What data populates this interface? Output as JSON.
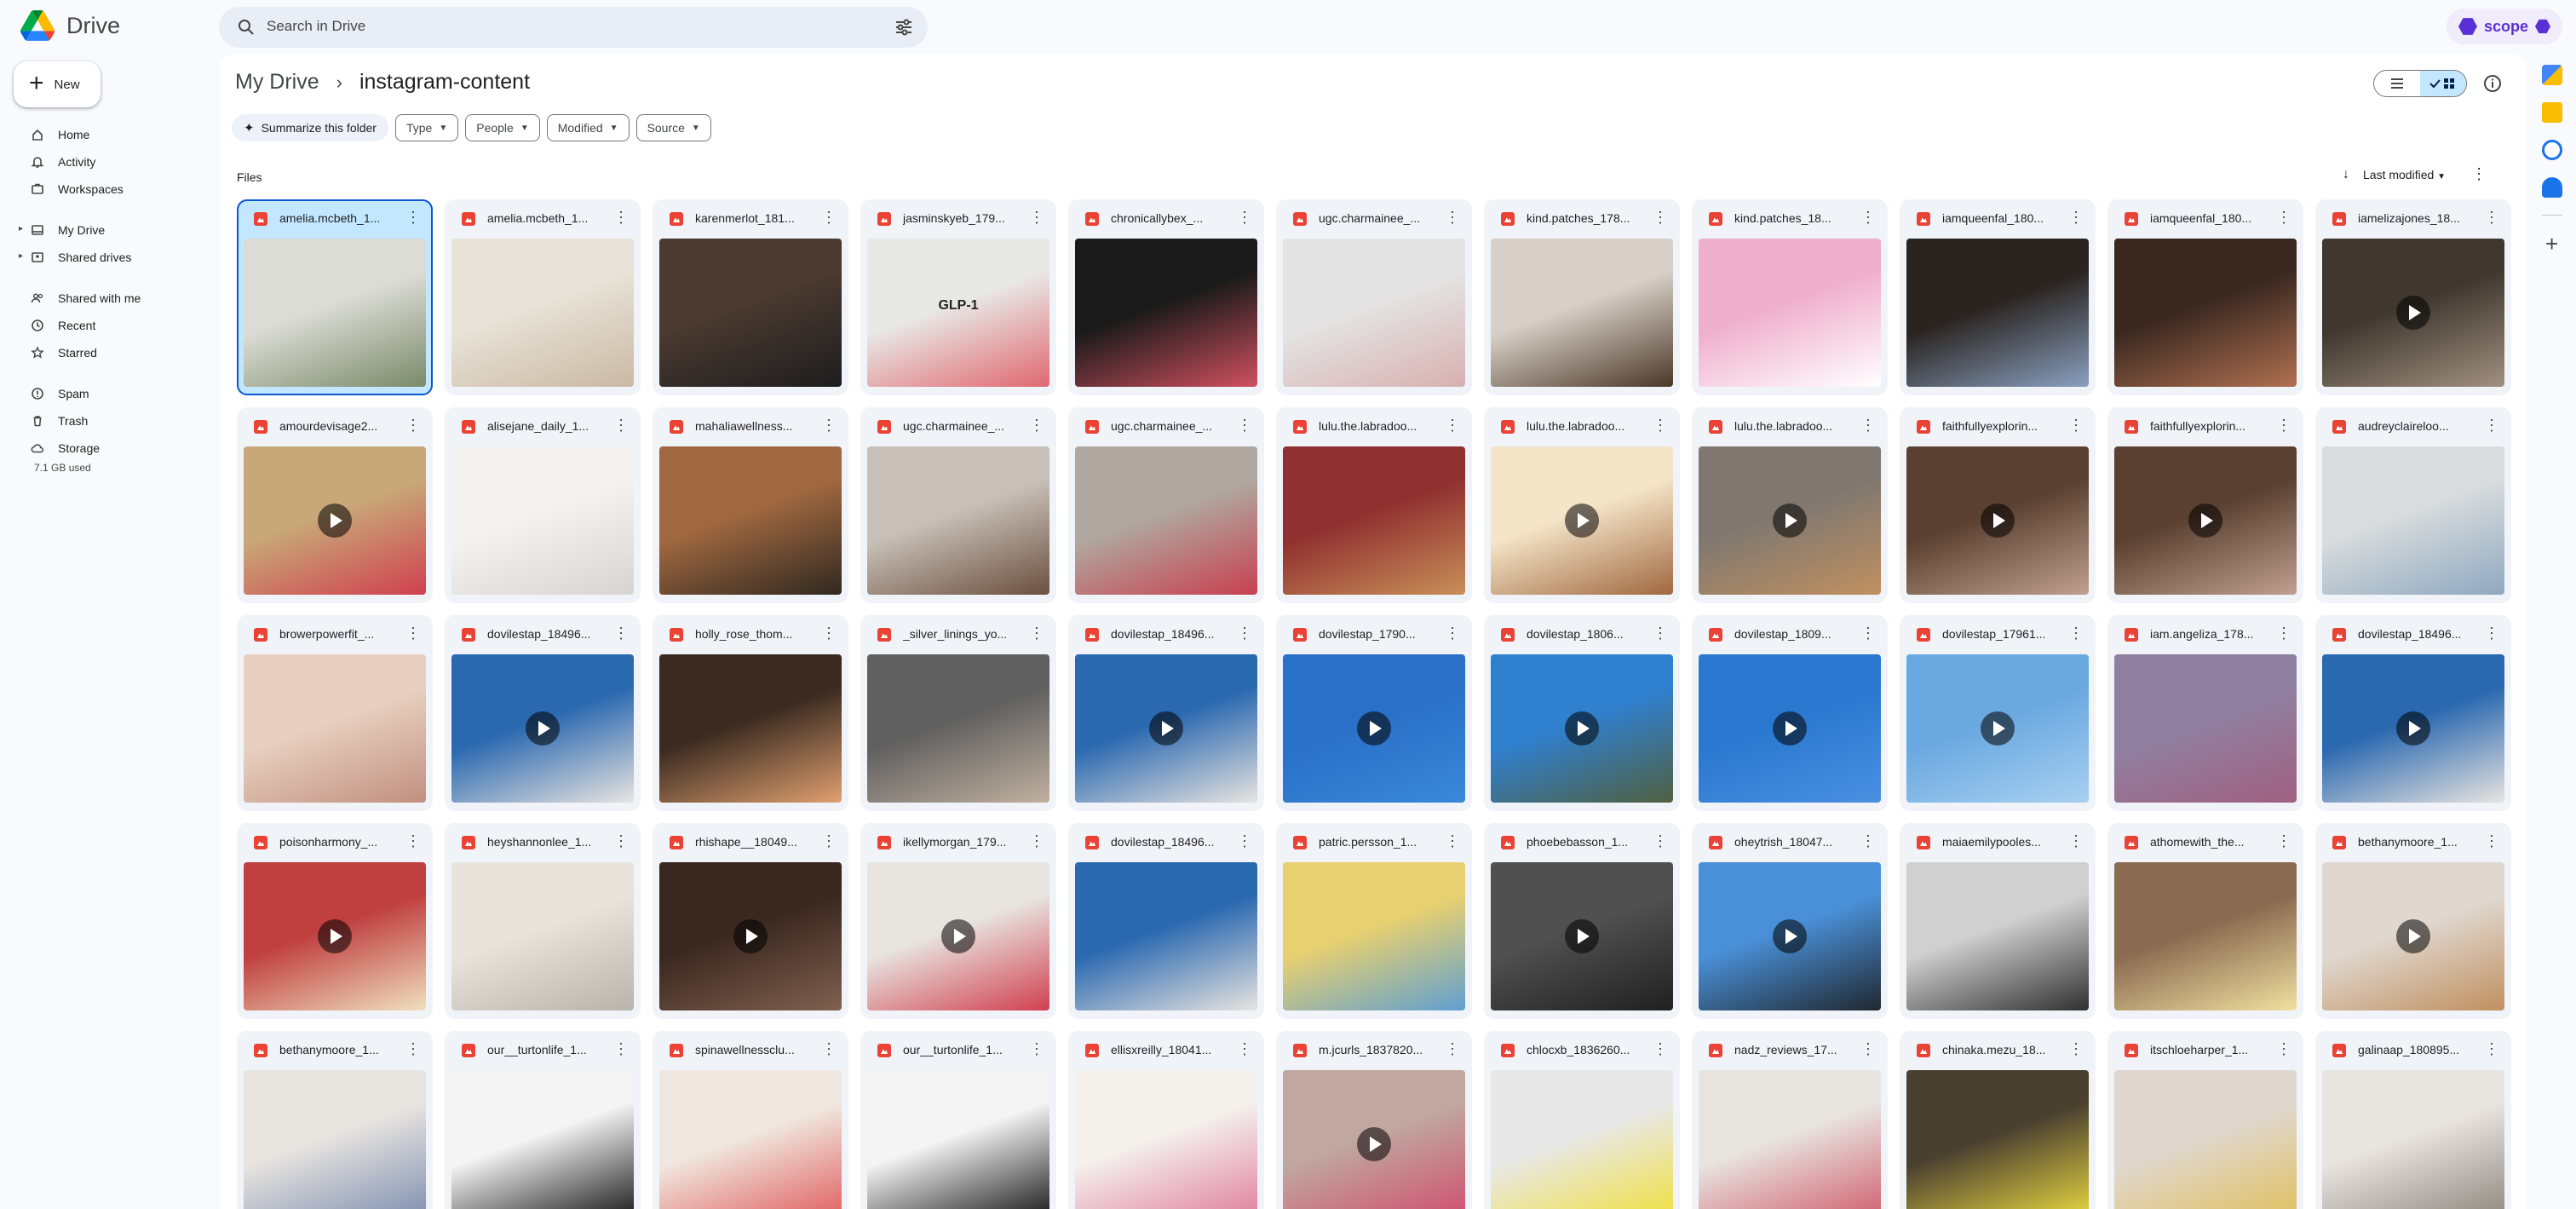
{
  "app": {
    "name": "Drive"
  },
  "search": {
    "placeholder": "Search in Drive"
  },
  "scope": {
    "label": "scope"
  },
  "new_button": {
    "label": "New"
  },
  "nav": [
    {
      "name": "home",
      "label": "Home",
      "icon": "home-icon"
    },
    {
      "name": "activity",
      "label": "Activity",
      "icon": "bell-icon"
    },
    {
      "name": "workspaces",
      "label": "Workspaces",
      "icon": "workspace-icon"
    },
    {
      "gap": true
    },
    {
      "name": "my-drive",
      "label": "My Drive",
      "icon": "drive-icon",
      "expandable": true
    },
    {
      "name": "shared-drives",
      "label": "Shared drives",
      "icon": "shared-drive-icon",
      "expandable": true
    },
    {
      "gap": true
    },
    {
      "name": "shared-with-me",
      "label": "Shared with me",
      "icon": "people-icon"
    },
    {
      "name": "recent",
      "label": "Recent",
      "icon": "clock-icon"
    },
    {
      "name": "starred",
      "label": "Starred",
      "icon": "star-icon"
    },
    {
      "gap": true
    },
    {
      "name": "spam",
      "label": "Spam",
      "icon": "spam-icon"
    },
    {
      "name": "trash",
      "label": "Trash",
      "icon": "trash-icon"
    },
    {
      "name": "storage",
      "label": "Storage",
      "icon": "cloud-icon"
    }
  ],
  "storage_used": "7.1 GB used",
  "breadcrumb": {
    "root": "My Drive",
    "current": "instagram-content"
  },
  "filters": {
    "summarize": "Summarize this folder",
    "chips": [
      "Type",
      "People",
      "Modified",
      "Source"
    ]
  },
  "section_label": "Files",
  "sort": {
    "label": "Last modified"
  },
  "files": [
    {
      "name": "amelia.mcbeth_1...",
      "video": false,
      "selected": true,
      "bg": [
        "#dcdcd6",
        "#7a8a6a"
      ]
    },
    {
      "name": "amelia.mcbeth_1...",
      "video": false,
      "bg": [
        "#e8e2d8",
        "#c9b9a4"
      ]
    },
    {
      "name": "karenmerlot_181...",
      "video": false,
      "bg": [
        "#4a3a30",
        "#1d1d1f"
      ]
    },
    {
      "name": "jasminskyeb_179...",
      "video": false,
      "bg": [
        "#e8e8e6",
        "#e06870"
      ],
      "text": "GLP-1"
    },
    {
      "name": "chronicallybex_...",
      "video": false,
      "bg": [
        "#1a1a1a",
        "#d05060"
      ]
    },
    {
      "name": "ugc.charmainee_...",
      "video": false,
      "bg": [
        "#e4e4e4",
        "#d8b0b0"
      ]
    },
    {
      "name": "kind.patches_178...",
      "video": false,
      "bg": [
        "#d8d0c8",
        "#4a3828"
      ]
    },
    {
      "name": "kind.patches_18...",
      "video": false,
      "bg": [
        "#f0b0cc",
        "#fff"
      ]
    },
    {
      "name": "iamqueenfal_180...",
      "video": false,
      "bg": [
        "#2a2420",
        "#8aa0c0"
      ]
    },
    {
      "name": "iamqueenfal_180...",
      "video": false,
      "bg": [
        "#3a2820",
        "#b07050"
      ]
    },
    {
      "name": "iamelizajones_18...",
      "video": true,
      "bg": [
        "#403830",
        "#a09080"
      ]
    },
    {
      "name": "amourdevisage2...",
      "video": true,
      "bg": [
        "#c8a878",
        "#d04050"
      ]
    },
    {
      "name": "alisejane_daily_1...",
      "video": false,
      "bg": [
        "#f4f2f0",
        "#d8d4d0"
      ]
    },
    {
      "name": "mahaliawellness...",
      "video": false,
      "bg": [
        "#a06840",
        "#302820"
      ]
    },
    {
      "name": "ugc.charmainee_...",
      "video": false,
      "bg": [
        "#c8c0b8",
        "#6a5040"
      ]
    },
    {
      "name": "ugc.charmainee_...",
      "video": false,
      "bg": [
        "#b0a8a0",
        "#c84050"
      ]
    },
    {
      "name": "lulu.the.labradoo...",
      "video": false,
      "bg": [
        "#903030",
        "#c89058"
      ]
    },
    {
      "name": "lulu.the.labradoo...",
      "video": true,
      "bg": [
        "#f4e4c8",
        "#a06840"
      ]
    },
    {
      "name": "lulu.the.labradoo...",
      "video": true,
      "bg": [
        "#807870",
        "#c09060"
      ]
    },
    {
      "name": "faithfullyexplorin...",
      "video": true,
      "bg": [
        "#5a4030",
        "#c0a090"
      ]
    },
    {
      "name": "faithfullyexplorin...",
      "video": true,
      "bg": [
        "#5a4030",
        "#c0a090"
      ]
    },
    {
      "name": "audreyclaireloo...",
      "video": false,
      "bg": [
        "#d8dcdc",
        "#90a8c0"
      ]
    },
    {
      "name": "browerpowerfit_...",
      "video": false,
      "bg": [
        "#e8d0c0",
        "#c09080"
      ]
    },
    {
      "name": "dovilestap_18496...",
      "video": true,
      "bg": [
        "#2a68b0",
        "#e8e4e0"
      ]
    },
    {
      "name": "holly_rose_thom...",
      "video": false,
      "bg": [
        "#3a2a20",
        "#e0a070"
      ]
    },
    {
      "name": "_silver_linings_yo...",
      "video": false,
      "bg": [
        "#606060",
        "#c0b0a0"
      ]
    },
    {
      "name": "dovilestap_18496...",
      "video": true,
      "bg": [
        "#2a68b0",
        "#e8e4e0"
      ]
    },
    {
      "name": "dovilestap_1790...",
      "video": true,
      "bg": [
        "#2a70c8",
        "#3a88d8"
      ]
    },
    {
      "name": "dovilestap_1806...",
      "video": true,
      "bg": [
        "#3080d0",
        "#506040"
      ]
    },
    {
      "name": "dovilestap_1809...",
      "video": true,
      "bg": [
        "#2a78d0",
        "#4a90e0"
      ]
    },
    {
      "name": "dovilestap_17961...",
      "video": true,
      "bg": [
        "#6aa8e0",
        "#a8d0f0"
      ]
    },
    {
      "name": "iam.angeliza_178...",
      "video": false,
      "bg": [
        "#9080a0",
        "#a06080"
      ]
    },
    {
      "name": "dovilestap_18496...",
      "video": true,
      "bg": [
        "#2a68b0",
        "#e8e4e0"
      ]
    },
    {
      "name": "poisonharmony_...",
      "video": true,
      "bg": [
        "#c04040",
        "#f0e0c0"
      ]
    },
    {
      "name": "heyshannonlee_1...",
      "video": false,
      "bg": [
        "#e8e4dc",
        "#b8b4ac"
      ]
    },
    {
      "name": "rhishape__18049...",
      "video": true,
      "bg": [
        "#3a2820",
        "#806050"
      ]
    },
    {
      "name": "ikellymorgan_179...",
      "video": true,
      "bg": [
        "#e8e4e0",
        "#d04050"
      ]
    },
    {
      "name": "dovilestap_18496...",
      "video": false,
      "bg": [
        "#2a68b0",
        "#e8e4e0"
      ]
    },
    {
      "name": "patric.persson_1...",
      "video": false,
      "bg": [
        "#e8d070",
        "#60a0d0"
      ]
    },
    {
      "name": "phoebebasson_1...",
      "video": true,
      "bg": [
        "#505050",
        "#202020"
      ]
    },
    {
      "name": "oheytrish_18047...",
      "video": true,
      "bg": [
        "#4a90d8",
        "#202830"
      ]
    },
    {
      "name": "maiaemilypooles...",
      "video": false,
      "bg": [
        "#d0d0d0",
        "#303030"
      ]
    },
    {
      "name": "athomewith_the...",
      "video": false,
      "bg": [
        "#8a6a50",
        "#f0e0a0"
      ]
    },
    {
      "name": "bethanymoore_1...",
      "video": true,
      "bg": [
        "#e0d8d0",
        "#c09060"
      ]
    },
    {
      "name": "bethanymoore_1...",
      "video": false,
      "bg": [
        "#e8e4e0",
        "#8090b0"
      ]
    },
    {
      "name": "our__turtonlife_1...",
      "video": false,
      "bg": [
        "#f4f4f4",
        "#1a1a1a"
      ]
    },
    {
      "name": "spinawellnessclu...",
      "video": false,
      "bg": [
        "#f0e8e0",
        "#e06060"
      ]
    },
    {
      "name": "our__turtonlife_1...",
      "video": false,
      "bg": [
        "#f4f4f4",
        "#1a1a1a"
      ]
    },
    {
      "name": "ellisxreilly_18041...",
      "video": false,
      "bg": [
        "#f4f0ec",
        "#e080a0"
      ]
    },
    {
      "name": "m.jcurls_1837820...",
      "video": true,
      "bg": [
        "#c0a8a0",
        "#d05070"
      ]
    },
    {
      "name": "chlocxb_1836260...",
      "video": false,
      "bg": [
        "#e8e8e8",
        "#f0e040"
      ]
    },
    {
      "name": "nadz_reviews_17...",
      "video": false,
      "bg": [
        "#e8e4e0",
        "#d06070"
      ]
    },
    {
      "name": "chinaka.mezu_18...",
      "video": false,
      "bg": [
        "#4a4030",
        "#e8d840"
      ]
    },
    {
      "name": "itschloeharper_1...",
      "video": false,
      "bg": [
        "#e0d8d0",
        "#e0c060"
      ]
    },
    {
      "name": "galinaap_180895...",
      "video": false,
      "bg": [
        "#e8e4e0",
        "#908880"
      ]
    }
  ],
  "colors": {
    "accent": "#0b57d0",
    "selected_bg": "#c2e7ff",
    "scope": "#5b2fd6"
  }
}
